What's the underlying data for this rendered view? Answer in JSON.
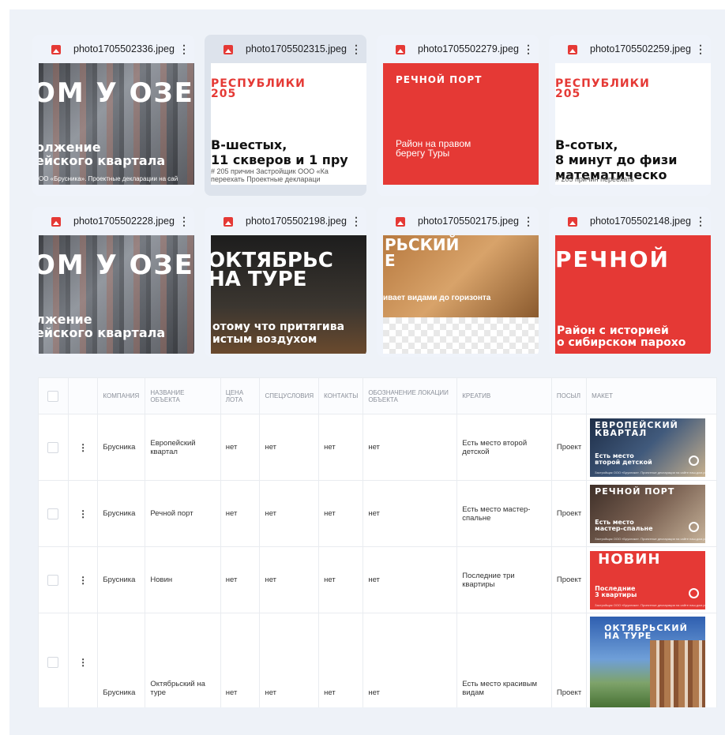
{
  "files": [
    {
      "name": "photo1705502336.jpeg",
      "kind": "dark",
      "big": "ОМ У ОЗЕ",
      "mid": "олжение\nейского квартала",
      "small": "ОО «Брусника». Проектные декларации на сай"
    },
    {
      "name": "photo1705502315.jpeg",
      "kind": "white",
      "red": "РЕСПУБЛИКИ\n205",
      "blk": "В-шестых,\n11 скверов и 1 пру",
      "tiny": "# 205 причин        Застройщик ООО «Ка\nпереехать              Проектные деклараци"
    },
    {
      "name": "photo1705502279.jpeg",
      "kind": "red",
      "head": "РЕЧНОЙ ПОРТ",
      "body": "Район на правом\nберегу Туры"
    },
    {
      "name": "photo1705502259.jpeg",
      "kind": "white",
      "red": "РЕСПУБЛИКИ\n205",
      "blk": "В-сотых,\n8 минут до физи\nматематическо",
      "tiny": "# 205 причин переехать"
    },
    {
      "name": "photo1705502228.jpeg",
      "kind": "dark",
      "big": "ОМ У ОЗЕ",
      "mid": "лжение\nейского квартала",
      "small": ""
    },
    {
      "name": "photo1705502198.jpeg",
      "kind": "photo",
      "big": "ОКТЯБРЬС\nНА ТУРЕ",
      "mid": "отому что притягива\nистым воздухом",
      "small": ""
    },
    {
      "name": "photo1705502175.jpeg",
      "kind": "check",
      "big": "РЬСКИЙ\nЕ",
      "mid": "ивает видами до горизонта"
    },
    {
      "name": "photo1705502148.jpeg",
      "kind": "red2",
      "big": "РЕЧНОЙ",
      "body": "Район с историей\nо сибирском парохо"
    }
  ],
  "table": {
    "headers": [
      "",
      "",
      "КОМПАНИЯ",
      "НАЗВАНИЕ ОБЪЕКТА",
      "ЦЕНА ЛОТА",
      "СПЕЦУСЛОВИЯ",
      "КОНТАКТЫ",
      "ОБОЗНАЧЕНИЕ ЛОКАЦИИ ОБЪЕКТА",
      "КРЕАТИВ",
      "ПОСЫЛ",
      "МАКЕТ"
    ],
    "rows": [
      {
        "company": "Брусника",
        "name": "Европейский квартал",
        "price": "нет",
        "special": "нет",
        "contacts": "нет",
        "location": "нет",
        "creative": "Есть место второй детской",
        "message": "Проект",
        "mk": {
          "t1": "ЕВРОПЕЙСКИЙ\nКВАРТАЛ",
          "t2": "Есть место\nвторой детской",
          "t3": "Застройщик ООО «Брусника». Проектные декларации на сайте наш.дом.рф"
        }
      },
      {
        "company": "Брусника",
        "name": "Речной порт",
        "price": "нет",
        "special": "нет",
        "contacts": "нет",
        "location": "нет",
        "creative": "Есть место мастер-спальне",
        "message": "Проект",
        "mk": {
          "t1": "РЕЧНОЙ ПОРТ",
          "t2": "Есть место\nмастер-спальне",
          "t3": "Застройщик ООО «Брусника». Проектные декларации на сайте наш.дом.рф"
        }
      },
      {
        "company": "Брусника",
        "name": "Новин",
        "price": "нет",
        "special": "нет",
        "contacts": "нет",
        "location": "нет",
        "creative": "Последние три квартиры",
        "message": "Проект",
        "mk": {
          "t1": "НОВИН",
          "t2": "Последние\n3 квартиры",
          "t3": "Застройщик ООО «Брусника». Проектные декларации на сайте наш.дом.рф"
        }
      },
      {
        "company": "Брусника",
        "name": "Октябрьский на туре",
        "price": "нет",
        "special": "нет",
        "contacts": "нет",
        "location": "нет",
        "creative": "Есть место красивым видам",
        "message": "Проект",
        "mk": {
          "t1": "ОКТЯБРЬСКИЙ\nНА ТУРЕ",
          "t2": "",
          "t3": ""
        }
      }
    ]
  }
}
